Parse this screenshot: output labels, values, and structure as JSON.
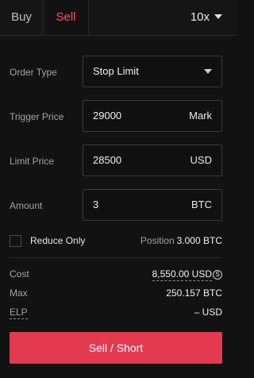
{
  "tabs": {
    "buy": "Buy",
    "sell": "Sell",
    "active": "sell"
  },
  "leverage": "10x",
  "order_type": {
    "label": "Order Type",
    "value": "Stop Limit"
  },
  "trigger_price": {
    "label": "Trigger Price",
    "value": "29000",
    "unit": "Mark"
  },
  "limit_price": {
    "label": "Limit Price",
    "value": "28500",
    "unit": "USD"
  },
  "amount": {
    "label": "Amount",
    "value": "3",
    "unit": "BTC"
  },
  "reduce_only": {
    "label": "Reduce Only",
    "checked": false
  },
  "position": {
    "label": "Position",
    "value": "3.000 BTC"
  },
  "summary": {
    "cost_label": "Cost",
    "cost_value": "8,550.00 USD",
    "cost_icon": "S",
    "max_label": "Max",
    "max_value": "250.157 BTC",
    "elp_label": "ELP",
    "elp_value": "– USD"
  },
  "cta": {
    "label": "Sell / Short"
  },
  "colors": {
    "accent": "#e33a4f",
    "active_tab_text": "#ff5068",
    "background": "#121212"
  }
}
